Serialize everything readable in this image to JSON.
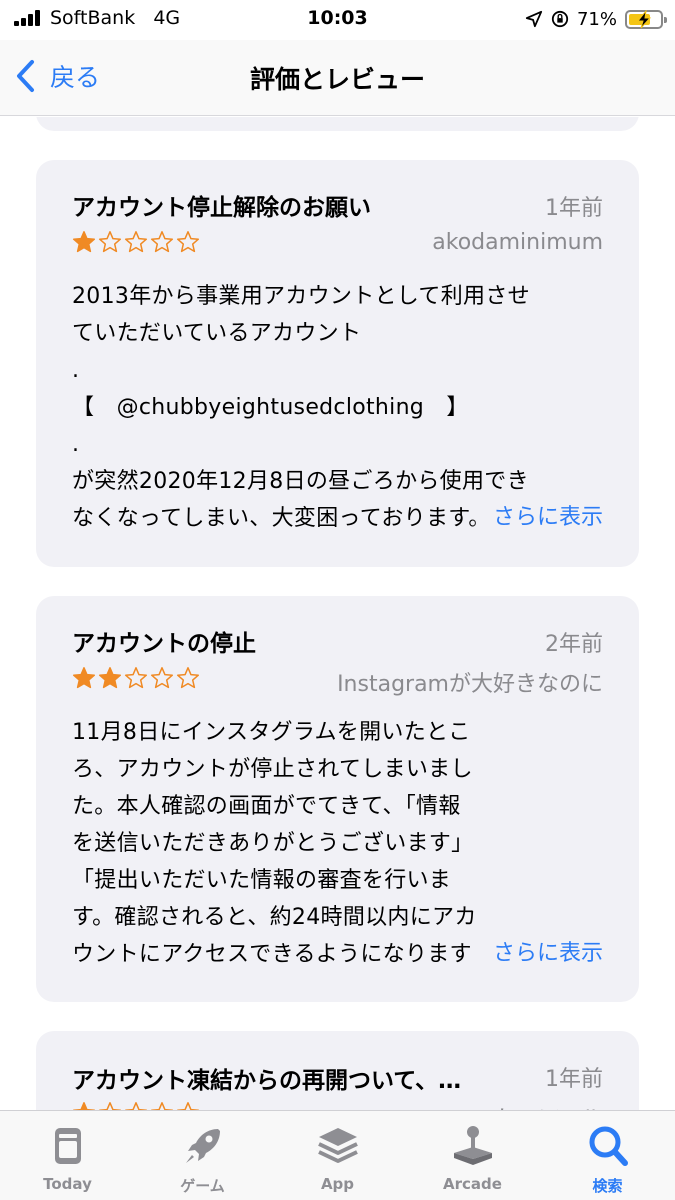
{
  "status_bar": {
    "carrier": "SoftBank",
    "network": "4G",
    "time": "10:03",
    "battery": "71%",
    "battery_level": 0.71
  },
  "nav": {
    "back_label": "戻る",
    "title": "評価とレビュー"
  },
  "reviews": [
    {
      "title": "アカウント停止解除のお願い",
      "date": "1年前",
      "rating": 1,
      "author": "akodaminimum",
      "body_lines": [
        "2013年から事業用アカウントとして利用させ",
        "ていただいているアカウント",
        ".",
        "【　@chubbyeightusedclothing　】",
        ".",
        "が突然2020年12月8日の昼ごろから使用でき",
        "なくなってしまい、大変困っております。"
      ],
      "more_label": "さらに表示"
    },
    {
      "title": "アカウントの停止",
      "date": "2年前",
      "rating": 2,
      "author": "Instagramが大好きなのに",
      "body_lines": [
        "11月8日にインスタグラムを開いたとこ",
        "ろ、アカウントが停止されてしまいまし",
        "た。本人確認の画面がでてきて、「情報",
        "を送信いただきありがとうございます」",
        "「提出いただいた情報の審査を行いま",
        "す。確認されると、約24時間以内にアカ",
        "ウントにアクセスできるようになります"
      ],
      "more_label": "さらに表示"
    },
    {
      "title": "アカウント凍結からの再開ついて、…",
      "date": "1年前",
      "rating": 1,
      "author": "ケニアール"
    }
  ],
  "tabs": [
    {
      "label": "Today",
      "icon": "today-icon",
      "active": false
    },
    {
      "label": "ゲーム",
      "icon": "rocket-icon",
      "active": false
    },
    {
      "label": "App",
      "icon": "app-stack-icon",
      "active": false
    },
    {
      "label": "Arcade",
      "icon": "joystick-icon",
      "active": false
    },
    {
      "label": "検索",
      "icon": "search-icon",
      "active": true
    }
  ],
  "colors": {
    "accent": "#2c7cf5",
    "star": "#f08a24",
    "card_bg": "#f1f1f6",
    "secondary_text": "#8a8a8e"
  }
}
